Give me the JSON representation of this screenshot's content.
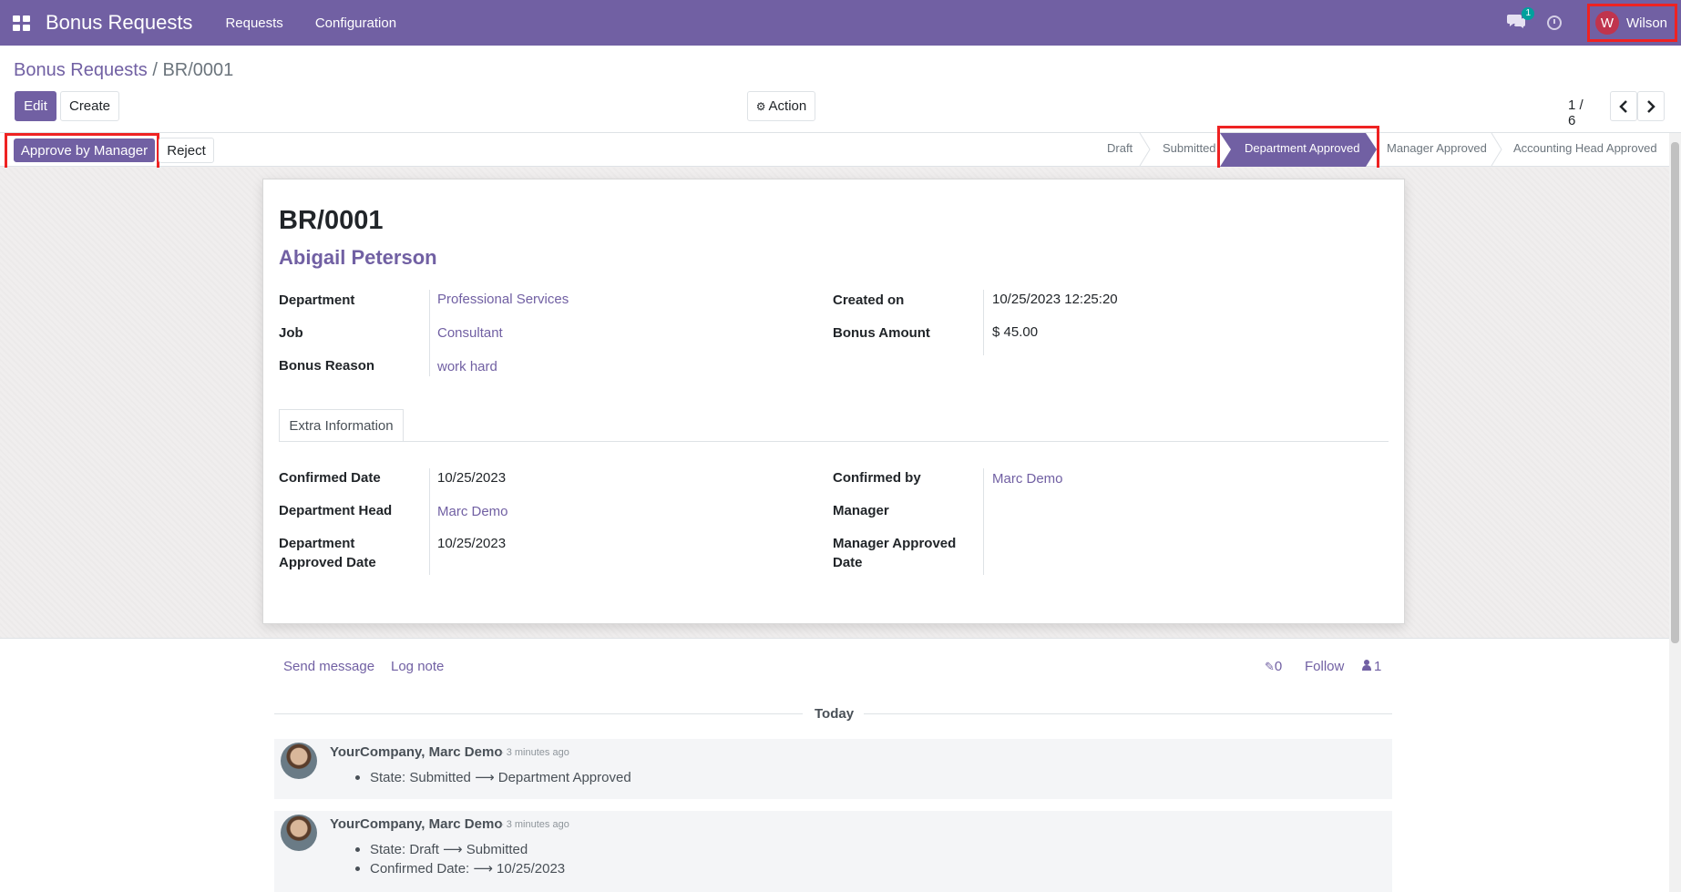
{
  "navbar": {
    "brand": "Bonus Requests",
    "menu": [
      "Requests",
      "Configuration"
    ],
    "chat_badge": "1",
    "user_initial": "W",
    "user_name": "Wilson"
  },
  "breadcrumb": {
    "parent": "Bonus Requests",
    "separator": "/",
    "current": "BR/0001"
  },
  "buttons": {
    "edit": "Edit",
    "create": "Create",
    "action": "Action",
    "approve": "Approve by Manager",
    "reject": "Reject"
  },
  "pager": {
    "text": "1 / 6"
  },
  "stages": [
    "Draft",
    "Submitted",
    "Department Approved",
    "Manager Approved",
    "Accounting Head Approved"
  ],
  "record": {
    "reference": "BR/0001",
    "employee": "Abigail Peterson",
    "fields_left": [
      {
        "label": "Department",
        "value": "Professional Services"
      },
      {
        "label": "Job",
        "value": "Consultant"
      },
      {
        "label": "Bonus Reason",
        "value": "work hard"
      }
    ],
    "fields_right": [
      {
        "label": "Created on",
        "value": "10/25/2023 12:25:20"
      },
      {
        "label": "Bonus Amount",
        "value": "$ 45.00"
      }
    ]
  },
  "tabs": {
    "extra": "Extra Information"
  },
  "extra": {
    "left": [
      {
        "label": "Confirmed Date",
        "value": "10/25/2023"
      },
      {
        "label": "Department Head",
        "value": "Marc Demo"
      },
      {
        "label_line1": "Department",
        "label_line2": "Approved Date",
        "value": "10/25/2023"
      }
    ],
    "right": [
      {
        "label": "Confirmed by",
        "value": "Marc Demo"
      },
      {
        "label": "Manager",
        "value": ""
      },
      {
        "label_line1": "Manager Approved",
        "label_line2": "Date",
        "value": ""
      }
    ]
  },
  "chatter": {
    "send_message": "Send message",
    "log_note": "Log note",
    "attachments": "0",
    "follow": "Follow",
    "followers": "1",
    "today": "Today",
    "messages": [
      {
        "author": "YourCompany, Marc Demo",
        "time": "- 3 minutes ago",
        "lines": [
          "State: Submitted ⟶ Department Approved"
        ]
      },
      {
        "author": "YourCompany, Marc Demo",
        "time": "- 3 minutes ago",
        "lines": [
          "State: Draft ⟶ Submitted",
          "Confirmed Date: ⟶ 10/25/2023"
        ]
      }
    ]
  }
}
